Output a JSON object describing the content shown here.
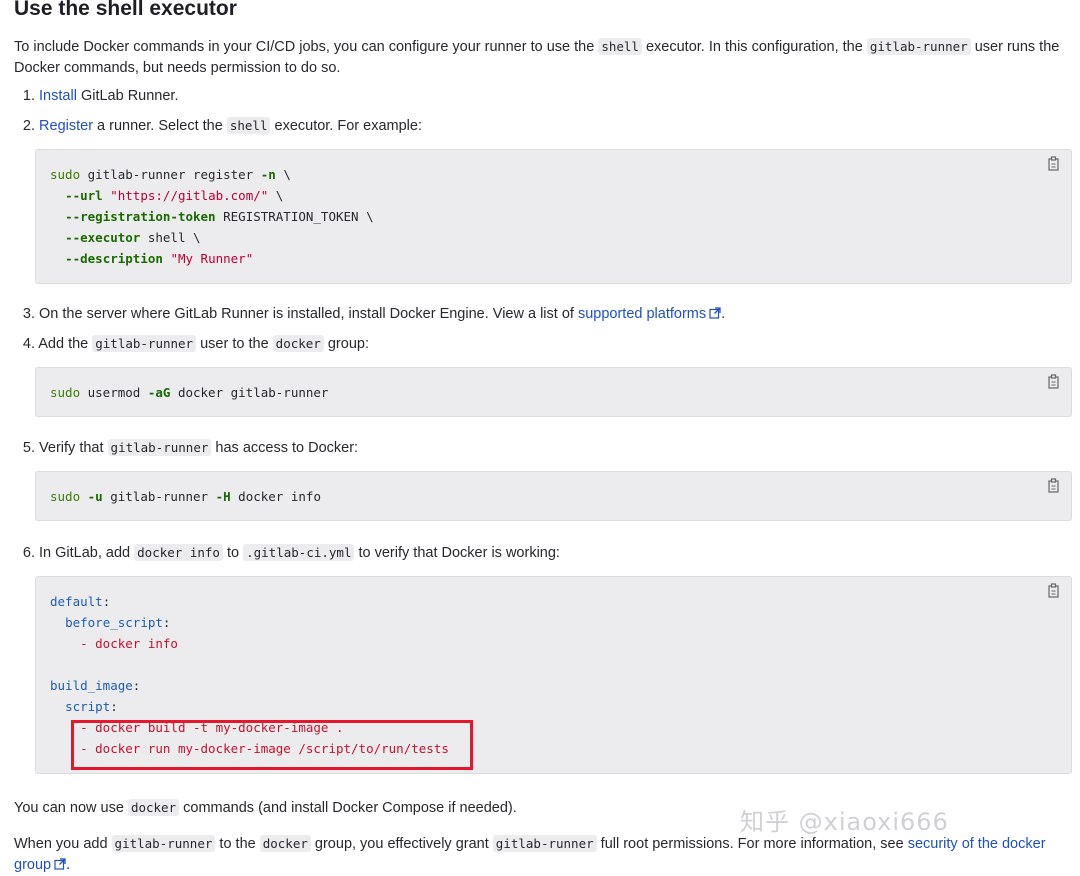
{
  "heading": "Use the shell executor",
  "intro": {
    "t1": "To include Docker commands in your CI/CD jobs, you can configure your runner to use the ",
    "c1": "shell",
    "t2": " executor. In this configuration, the ",
    "c2": "gitlab-runner",
    "t3": " user runs the Docker commands, but needs permission to do so."
  },
  "steps": [
    {
      "num": "1.",
      "link": "Install",
      "text": " GitLab Runner."
    },
    {
      "num": "2.",
      "link": "Register",
      "text1": " a runner. Select the ",
      "code": "shell",
      "text2": " executor. For example:"
    },
    {
      "num": "3.",
      "text": "On the server where GitLab Runner is installed, install Docker Engine. View a list of ",
      "link": "supported platforms",
      "end": "."
    },
    {
      "num": "4.",
      "text1": "Add the ",
      "code1": "gitlab-runner",
      "text2": " user to the ",
      "code2": "docker",
      "text3": " group:"
    },
    {
      "num": "5.",
      "text1": "Verify that ",
      "code1": "gitlab-runner",
      "text2": " has access to Docker:"
    },
    {
      "num": "6.",
      "text1": "In GitLab, add ",
      "code1": "docker info",
      "text2": " to ",
      "code2": ".gitlab-ci.yml",
      "text3": " to verify that Docker is working:"
    }
  ],
  "code_register": {
    "l1": [
      "sudo",
      " gitlab-runner register ",
      "-n",
      " \\"
    ],
    "l2": [
      "--url",
      " ",
      "\"https://gitlab.com/\"",
      " \\"
    ],
    "l3": [
      "--registration-token",
      " REGISTRATION_TOKEN \\"
    ],
    "l4": [
      "--executor",
      " shell \\"
    ],
    "l5": [
      "--description",
      " ",
      "\"My Runner\""
    ]
  },
  "code_usermod": [
    "sudo",
    " usermod ",
    "-aG",
    " docker gitlab-runner"
  ],
  "code_verify": [
    "sudo",
    " ",
    "-u",
    " gitlab-runner ",
    "-H",
    " docker info"
  ],
  "code_yaml": {
    "default": "default",
    "before_script": "before_script",
    "docker_info": "- docker info",
    "build_image": "build_image",
    "script": "script",
    "build_cmd": "- docker build -t my-docker-image .",
    "run_cmd": "- docker run my-docker-image /script/to/run/tests"
  },
  "after1": {
    "t1": "You can now use ",
    "c1": "docker",
    "t2": " commands (and install Docker Compose if needed)."
  },
  "after2": {
    "t1": "When you add ",
    "c1": "gitlab-runner",
    "t2": " to the ",
    "c2": "docker",
    "t3": " group, you effectively grant ",
    "c3": "gitlab-runner",
    "t4": " full root permissions. For more information, see ",
    "link": "security of the docker group",
    "end": "."
  },
  "watermark": "知乎 @xiaoxi666",
  "colors": {
    "link": "#1f4fbf",
    "highlight_box": "#e3182c",
    "code_bg": "#ececef"
  }
}
